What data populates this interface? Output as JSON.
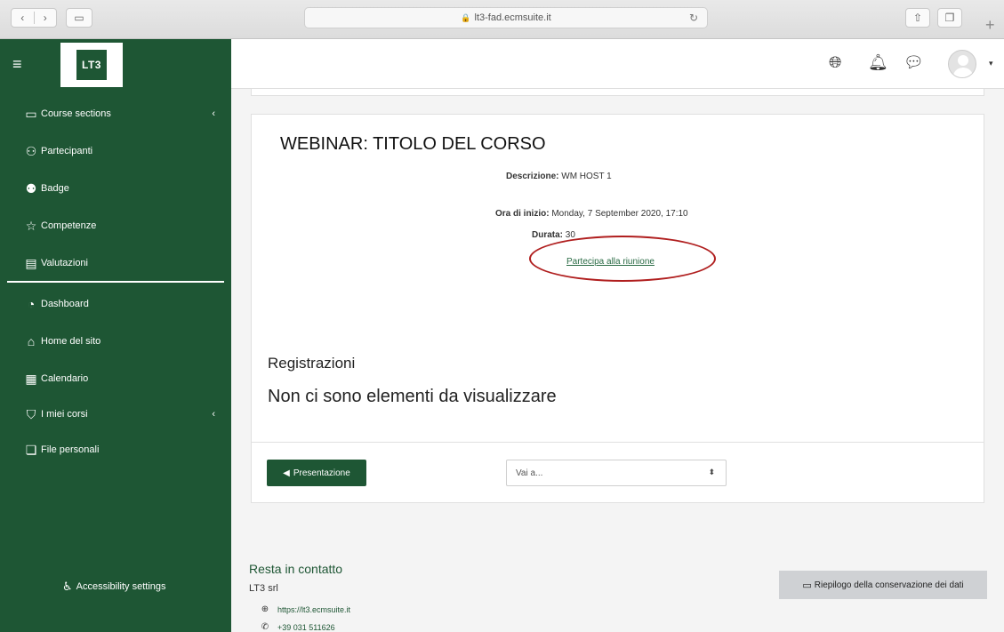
{
  "browser": {
    "url": "lt3-fad.ecmsuite.it",
    "back_glyph": "‹",
    "forward_glyph": "›"
  },
  "brand": {
    "logo_text": "LT3",
    "accent_color": "#1e5634"
  },
  "sidebar": {
    "items": [
      {
        "label": "Course sections",
        "icon": "folder-icon"
      },
      {
        "label": "Partecipanti",
        "icon": "users-icon"
      },
      {
        "label": "Badge",
        "icon": "badge-icon"
      },
      {
        "label": "Competenze",
        "icon": "star-icon"
      },
      {
        "label": "Valutazioni",
        "icon": "gradebook-icon"
      },
      {
        "label": "Dashboard",
        "icon": "dashboard-icon"
      },
      {
        "label": "Home del sito",
        "icon": "home-icon"
      },
      {
        "label": "Calendario",
        "icon": "calendar-icon"
      },
      {
        "label": "I miei corsi",
        "icon": "graduation-cap-icon"
      },
      {
        "label": "File personali",
        "icon": "files-icon"
      }
    ],
    "accessibility_label": "Accessibility settings"
  },
  "activity": {
    "title": "WEBINAR: TITOLO DEL CORSO",
    "description_label": "Descrizione:",
    "description_value": "WM HOST 1",
    "start_label": "Ora di inizio:",
    "start_value": "Monday, 7 September 2020, 17:10",
    "duration_label": "Durata:",
    "duration_value": "30",
    "join_label": "Partecipa alla riunione"
  },
  "recordings": {
    "title": "Registrazioni",
    "empty_text": "Non ci sono elementi da visualizzare"
  },
  "navigation": {
    "prev_label": "Presentazione",
    "jump_placeholder": "Vai a..."
  },
  "footer": {
    "contact_title": "Resta in contatto",
    "company": "LT3 srl",
    "website": "https://lt3.ecmsuite.it",
    "phone": "+39 031 511626",
    "data_retention_label": "Riepilogo della conservazione dei dati"
  }
}
